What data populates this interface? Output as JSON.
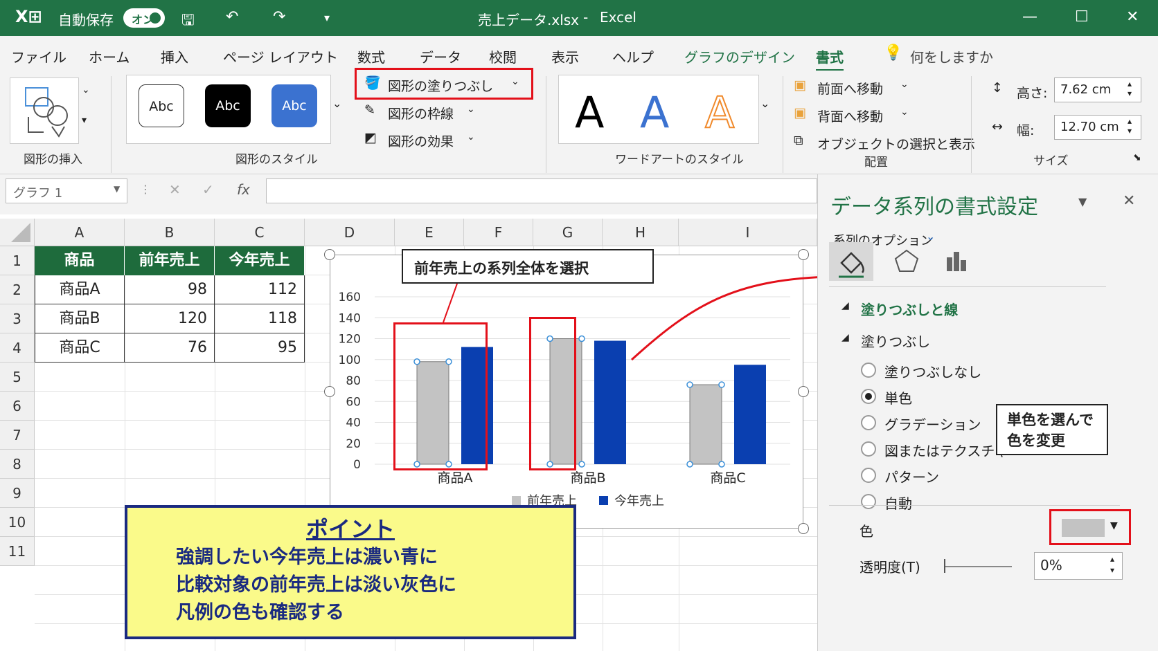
{
  "titlebar": {
    "autosave": "自動保存",
    "autosave_state": "オン",
    "filename": "売上データ.xlsx",
    "sep": "-",
    "app": "Excel"
  },
  "menu": [
    "ファイル",
    "ホーム",
    "挿入",
    "ページ レイアウト",
    "数式",
    "データ",
    "校閲",
    "表示",
    "ヘルプ",
    "グラフのデザイン",
    "書式"
  ],
  "tellme": "何をしますか",
  "ribbon": {
    "insert_shapes": "図形の挿入",
    "styles_label": "図形のスタイル",
    "abc": "Abc",
    "fill": "図形の塗りつぶし",
    "outline": "図形の枠線",
    "effect": "図形の効果",
    "wordart_label": "ワードアートのスタイル",
    "wordart_letter": "A",
    "front": "前面へ移動",
    "back": "背面へ移動",
    "select_pane": "オブジェクトの選択と表示",
    "arrange_label": "配置",
    "height_label": "高さ:",
    "height_val": "7.62 cm",
    "width_label": "幅:",
    "width_val": "12.70 cm",
    "size_label": "サイズ"
  },
  "namebox": "グラフ 1",
  "fx": "fx",
  "columns": [
    "A",
    "B",
    "C",
    "D",
    "E",
    "F",
    "G",
    "H",
    "I"
  ],
  "rows": [
    "1",
    "2",
    "3",
    "4",
    "5",
    "6",
    "7",
    "8",
    "9",
    "10",
    "11"
  ],
  "table": {
    "headers": [
      "商品",
      "前年売上",
      "今年売上"
    ],
    "rows": [
      [
        "商品A",
        "98",
        "112"
      ],
      [
        "商品B",
        "120",
        "118"
      ],
      [
        "商品C",
        "76",
        "95"
      ]
    ]
  },
  "chart_data": {
    "type": "bar",
    "categories": [
      "商品A",
      "商品B",
      "商品C"
    ],
    "series": [
      {
        "name": "前年売上",
        "values": [
          98,
          120,
          76
        ],
        "color": "#c3c3c3"
      },
      {
        "name": "今年売上",
        "values": [
          112,
          118,
          95
        ],
        "color": "#0a3fb0"
      }
    ],
    "ylim": [
      0,
      160
    ],
    "yticks": [
      "0",
      "20",
      "40",
      "60",
      "80",
      "100",
      "120",
      "140",
      "160"
    ],
    "legend": "bottom",
    "grid": true
  },
  "callout_select": "前年売上の系列全体を選択",
  "point": {
    "title": "ポイント",
    "lines": [
      "強調したい今年売上は濃い青に",
      "比較対象の前年売上は淡い灰色に",
      "凡例の色も確認する"
    ]
  },
  "pane": {
    "title": "データ系列の書式設定",
    "options": "系列のオプション",
    "section": "塗りつぶしと線",
    "subsection": "塗りつぶし",
    "radios": [
      "塗りつぶしなし",
      "単色",
      "グラデーション",
      "図またはテクスチャ",
      "パターン",
      "自動"
    ],
    "selected": 1,
    "color_label": "色",
    "transparency_label": "透明度(T)",
    "transparency_val": "0%",
    "swatch": "#c3c3c3",
    "callout": [
      "単色を選んで",
      "色を変更"
    ]
  }
}
